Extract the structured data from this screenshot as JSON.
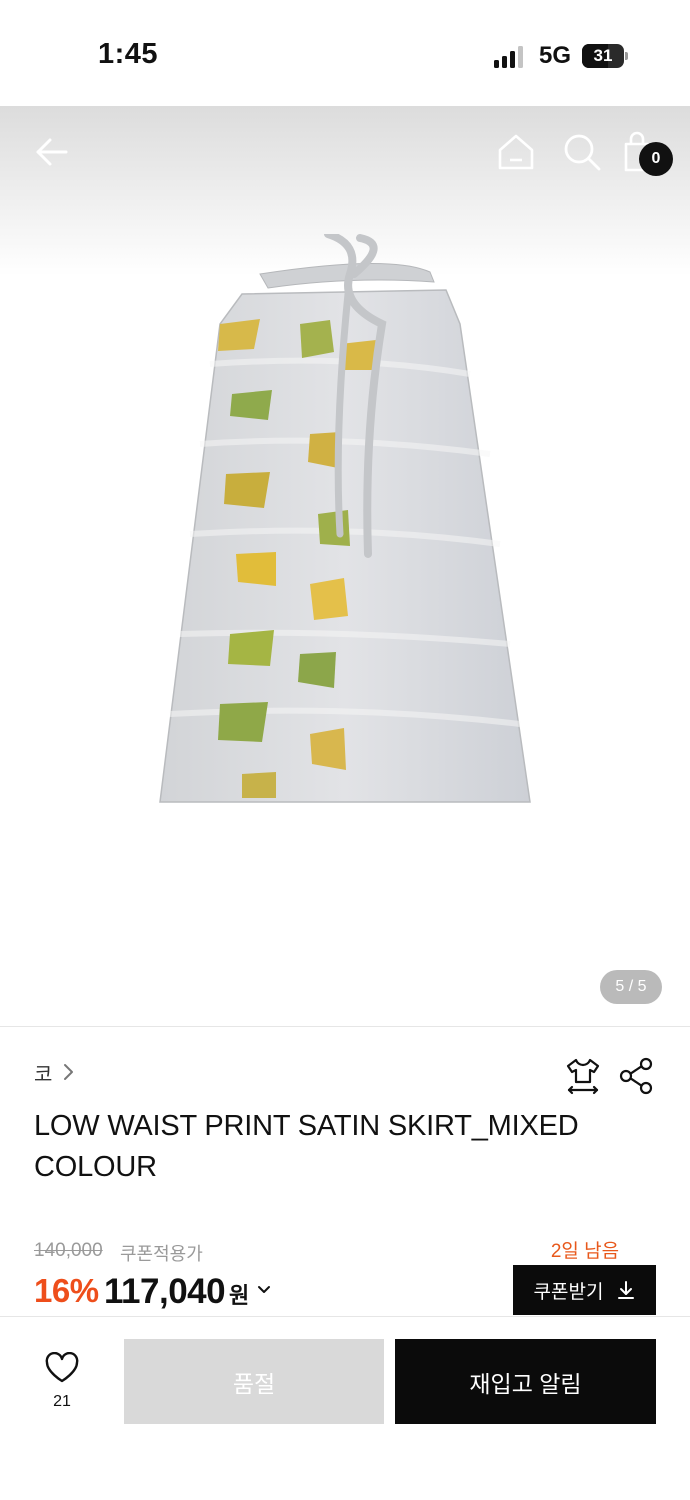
{
  "status_bar": {
    "time": "1:45",
    "network": "5G",
    "battery_level": "31"
  },
  "colors": {
    "accent": "#ee4e1b",
    "days_left": "#e8581b",
    "primary_button": "#0b0b0b",
    "disabled_button": "#d9d9d9"
  },
  "header": {
    "back_icon": "arrow-left-icon",
    "home_icon": "home-icon",
    "search_icon": "search-icon",
    "cart_icon": "shopping-bag-icon",
    "cart_count": "0"
  },
  "gallery": {
    "page_indicator": "5 / 5",
    "current_page": 5,
    "total_pages": 5
  },
  "product": {
    "brand": "코",
    "title": "LOW WAIST PRINT SATIN SKIRT_MIXED COLOUR",
    "original_price": "140,000",
    "coupon_note": "쿠폰적용가",
    "days_left": "2일 남음",
    "discount": "16%",
    "price": "117,040",
    "currency": "원",
    "coupon_button": "쿠폰받기"
  },
  "bottom_bar": {
    "like_count": "21",
    "soldout_label": "품절",
    "restock_label": "재입고 알림"
  }
}
